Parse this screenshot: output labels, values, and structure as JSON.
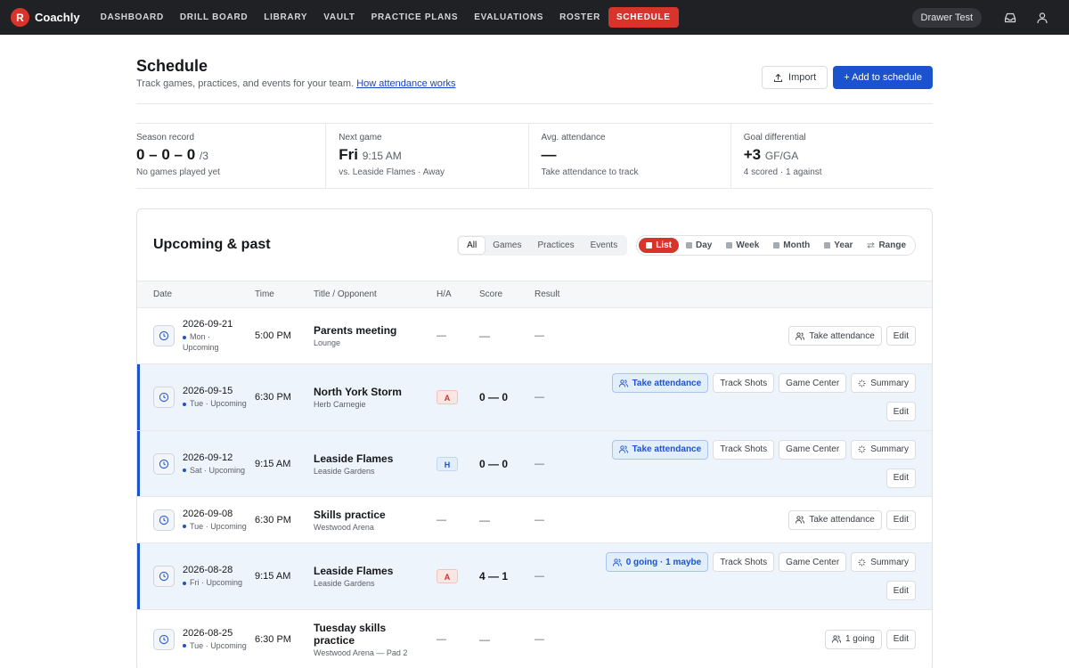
{
  "nav": {
    "logo_letter": "R",
    "brand": "Coachly",
    "items": [
      "DASHBOARD",
      "DRILL BOARD",
      "LIBRARY",
      "VAULT",
      "PRACTICE PLANS",
      "EVALUATIONS",
      "ROSTER",
      "SCHEDULE"
    ],
    "active": "SCHEDULE",
    "user": "Drawer Test"
  },
  "header": {
    "title": "Schedule",
    "subtitle": "Track games, practices, and events for your team.",
    "link": "How attendance works",
    "import_label": "Import",
    "add_label": "+ Add to schedule"
  },
  "stats": [
    {
      "label": "Season record",
      "value": "0 – 0 – 0",
      "suffix": "/3",
      "foot": "No games played yet"
    },
    {
      "label": "Next game",
      "value": "Fri",
      "suffix": "9:15 AM",
      "foot": "vs. Leaside Flames · Away"
    },
    {
      "label": "Avg. attendance",
      "value": "—",
      "suffix": "",
      "foot": "Take attendance to track"
    },
    {
      "label": "Goal differential",
      "value": "+3",
      "suffix": "GF/GA",
      "foot": "4 scored · 1 against"
    }
  ],
  "card": {
    "title": "Upcoming & past",
    "filters": [
      "All",
      "Games",
      "Practices",
      "Events"
    ],
    "views": [
      "List",
      "Day",
      "Week",
      "Month",
      "Year",
      "Range"
    ],
    "columns": [
      "Date",
      "Time",
      "Title / Opponent",
      "H/A",
      "Score",
      "Result"
    ]
  },
  "rows": [
    {
      "date": "2026-09-21",
      "day": "Mon ·",
      "status": "Upcoming",
      "time": "5:00 PM",
      "title": "Parents meeting",
      "location": "Lounge",
      "ha": "—",
      "score": "—",
      "result": "—",
      "game": false
    },
    {
      "date": "2026-09-15",
      "day": "Tue",
      "status": "Upcoming",
      "time": "6:30 PM",
      "title": "North York Storm",
      "location": "Herb Carnegie",
      "ha": "A",
      "score": "0 — 0",
      "result": "—",
      "game": true,
      "attendance": "Take attendance"
    },
    {
      "date": "2026-09-12",
      "day": "Sat",
      "status": "Upcoming",
      "time": "9:15 AM",
      "title": "Leaside Flames",
      "location": "Leaside Gardens",
      "ha": "H",
      "score": "0 — 0",
      "result": "—",
      "game": true,
      "attendance": "Take attendance"
    },
    {
      "date": "2026-09-08",
      "day": "Tue",
      "status": "Upcoming",
      "time": "6:30 PM",
      "title": "Skills practice",
      "location": "Westwood Arena",
      "ha": "—",
      "score": "—",
      "result": "—",
      "game": false,
      "attendance": "Take attendance"
    },
    {
      "date": "2026-08-28",
      "day": "Fri",
      "status": "Upcoming",
      "time": "9:15 AM",
      "title": "Leaside Flames",
      "location": "Leaside Gardens",
      "ha": "A",
      "score": "4 — 1",
      "result": "—",
      "game": true,
      "attendance": "0 going · 1 maybe"
    },
    {
      "date": "2026-08-25",
      "day": "Tue",
      "status": "Upcoming",
      "time": "6:30 PM",
      "title": "Tuesday skills practice",
      "location": "Westwood Arena — Pad 2",
      "ha": "—",
      "score": "—",
      "result": "—",
      "game": false,
      "attendance": "1 going"
    }
  ],
  "actions": {
    "track_shots": "Track Shots",
    "game_center": "Game Center",
    "summary": "Summary",
    "edit": "Edit"
  }
}
